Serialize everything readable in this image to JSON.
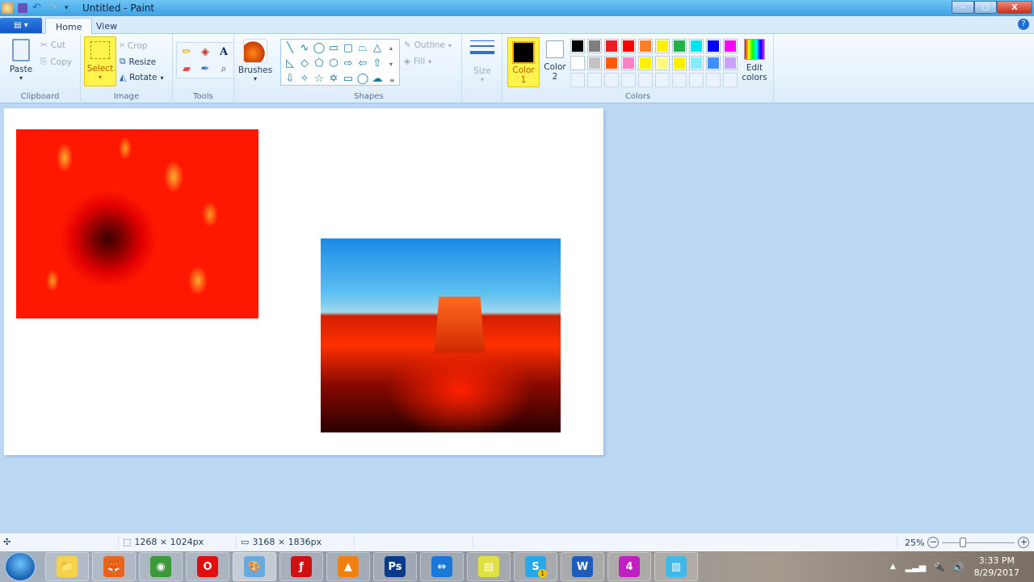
{
  "window": {
    "title": "Untitled - Paint",
    "controls": {
      "minimize": "–",
      "maximize": "▢",
      "close": "X"
    }
  },
  "tabs": {
    "file_menu": "▤ ▾",
    "items": [
      {
        "label": "Home",
        "active": true
      },
      {
        "label": "View",
        "active": false
      }
    ],
    "help": "?"
  },
  "ribbon": {
    "clipboard": {
      "label": "Clipboard",
      "paste": "Paste",
      "cut": "Cut",
      "copy": "Copy"
    },
    "image": {
      "label": "Image",
      "select": "Select",
      "crop": "Crop",
      "resize": "Resize",
      "rotate": "Rotate"
    },
    "tools": {
      "label": "Tools",
      "items": [
        "pencil",
        "fill",
        "text",
        "eraser",
        "color-picker",
        "magnifier"
      ]
    },
    "brushes": {
      "label": "Brushes"
    },
    "shapes": {
      "label": "Shapes",
      "outline": "Outline",
      "fill": "Fill",
      "glyphs": [
        "╲",
        "∿",
        "◯",
        "▭",
        "▢",
        "⏢",
        "△",
        "◺",
        "◇",
        "⬠",
        "⬡",
        "⇨",
        "⇦",
        "⇧",
        "⇩",
        "✧",
        "☆",
        "✡",
        "▭",
        "◯",
        "☁"
      ]
    },
    "size": {
      "label": "Size"
    },
    "colors": {
      "label": "Colors",
      "color1": "Color 1",
      "color1_value": "#000000",
      "color2": "Color 2",
      "color2_value": "#ffffff",
      "edit_colors": "Edit colors",
      "palette_row1": [
        "#000000",
        "#7f7f7f",
        "#ed1c24",
        "#ff0000",
        "#ff7f27",
        "#fff200",
        "#22b14c",
        "#00e5ee",
        "#0000ff",
        "#ff00ff"
      ],
      "palette_row2": [
        "#ffffff",
        "#c3c3c3",
        "#ff5a0a",
        "#ff7fc8",
        "#fff200",
        "#fffa80",
        "#ffee00",
        "#80f0ff",
        "#3f8fff",
        "#c8a0ff"
      ],
      "palette_row3": [
        "",
        "",
        "",
        "",
        "",
        "",
        "",
        "",
        "",
        ""
      ]
    }
  },
  "canvas": {
    "images": [
      {
        "name": "flower-image",
        "description": "red-toned flower close-up"
      },
      {
        "name": "desert-image",
        "description": "red desert butte landscape with blue sky"
      }
    ]
  },
  "statusbar": {
    "selection_size": "1268 × 1024px",
    "image_size": "3168 × 1836px",
    "zoom": "25%",
    "zoom_fraction": 0.25
  },
  "taskbar": {
    "apps": [
      "File Explorer",
      "Firefox",
      "Chrome",
      "Opera",
      "Paint",
      "Flash",
      "VLC",
      "Photoshop",
      "TeamViewer",
      "Sticky Notes",
      "Skype",
      "Word",
      "App 4",
      "Notepad"
    ],
    "skype_badge": "1",
    "time": "3:33 PM",
    "date": "8/29/2017"
  }
}
